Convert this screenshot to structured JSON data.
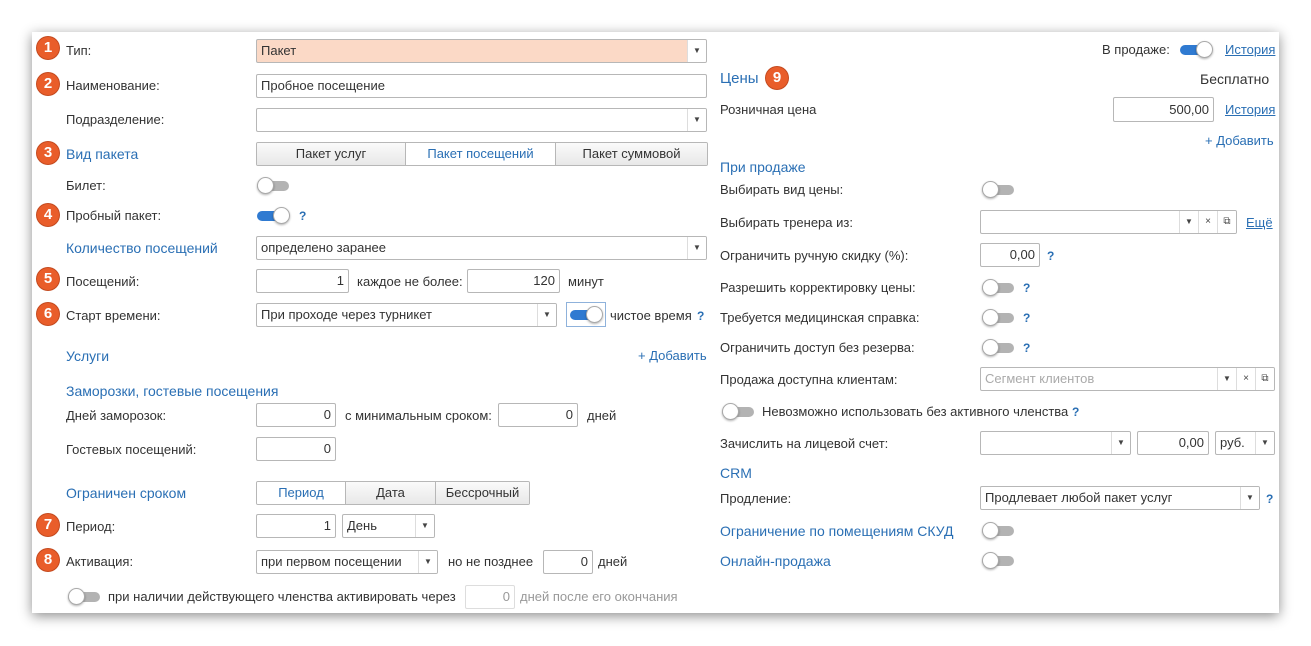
{
  "left": {
    "type_label": "Тип:",
    "type_value": "Пакет",
    "name_label": "Наименование:",
    "name_value": "Пробное посещение",
    "division_label": "Подразделение:",
    "division_value": "",
    "package_kind_label": "Вид пакета",
    "package_kind_options": [
      "Пакет услуг",
      "Пакет посещений",
      "Пакет суммовой"
    ],
    "package_kind_selected": "Пакет посещений",
    "ticket_label": "Билет:",
    "trial_label": "Пробный пакет:",
    "visits_count_label": "Количество посещений",
    "visits_count_value": "определено заранее",
    "visits_label": "Посещений:",
    "visits_value": "1",
    "each_max_label": "каждое не более:",
    "each_max_value": "120",
    "minutes_label": "минут",
    "time_start_label": "Старт времени:",
    "time_start_value": "При проходе через турникет",
    "net_time_label": "чистое время",
    "services_label": "Услуги",
    "services_add": "+ Добавить",
    "freeze_title": "Заморозки, гостевые посещения",
    "freeze_days_label": "Дней заморозок:",
    "freeze_days_value": "0",
    "min_term_label": "с минимальным сроком:",
    "min_term_value": "0",
    "days_label": "дней",
    "guest_visits_label": "Гостевых посещений:",
    "guest_visits_value": "0",
    "limited_label": "Ограничен сроком",
    "limited_options": [
      "Период",
      "Дата",
      "Бессрочный"
    ],
    "limited_selected": "Период",
    "period_label": "Период:",
    "period_value": "1",
    "period_unit": "День",
    "activation_label": "Активация:",
    "activation_value": "при первом посещении",
    "no_later_label": "но не позднее",
    "no_later_value": "0",
    "no_later_days": "дней",
    "membership_activate_label": "при наличии действующего членства активировать через",
    "membership_activate_value": "0",
    "membership_after_label": "дней после его окончания",
    "question": "?"
  },
  "right": {
    "on_sale_label": "В продаже:",
    "history_link": "История",
    "prices_title": "Цены",
    "free_label": "Бесплатно",
    "retail_price_label": "Розничная цена",
    "retail_price_value": "500,00",
    "history_link2": "История",
    "add_link": "+ Добавить",
    "on_sale_section": "При продаже",
    "choose_price_kind_label": "Выбирать вид цены:",
    "choose_trainer_label": "Выбирать тренера из:",
    "more_link": "Ещё",
    "limit_discount_label": "Ограничить ручную скидку (%):",
    "limit_discount_value": "0,00",
    "allow_price_edit_label": "Разрешить корректировку цены:",
    "medical_cert_label": "Требуется медицинская справка:",
    "limit_no_reserve_label": "Ограничить доступ без резерва:",
    "sale_clients_label": "Продажа доступна клиентам:",
    "sale_clients_placeholder": "Сегмент клиентов",
    "no_membership_label": "Невозможно использовать без активного членства",
    "credit_account_label": "Зачислить на лицевой счет:",
    "credit_account_value": "",
    "credit_amount": "0,00",
    "currency": "руб.",
    "crm_title": "CRM",
    "renewal_label": "Продление:",
    "renewal_value": "Продлевает любой пакет услуг",
    "skud_label": "Ограничение по помещениям СКУД",
    "online_sale_label": "Онлайн-продажа",
    "question": "?"
  },
  "badges": [
    "1",
    "2",
    "3",
    "4",
    "5",
    "6",
    "7",
    "8",
    "9"
  ],
  "toggles": {
    "ticket": false,
    "trial": true,
    "net_time": true,
    "membership_activate": false,
    "on_sale": true,
    "choose_price_kind": false,
    "allow_price_edit": false,
    "medical_cert": false,
    "limit_no_reserve": false,
    "no_membership": false,
    "skud": false,
    "online_sale": false
  },
  "colors": {
    "accent": "#2f7ad1",
    "link": "#2a6fb4",
    "badge": "#e95d2a",
    "type_field_bg": "#fbd9c6"
  }
}
